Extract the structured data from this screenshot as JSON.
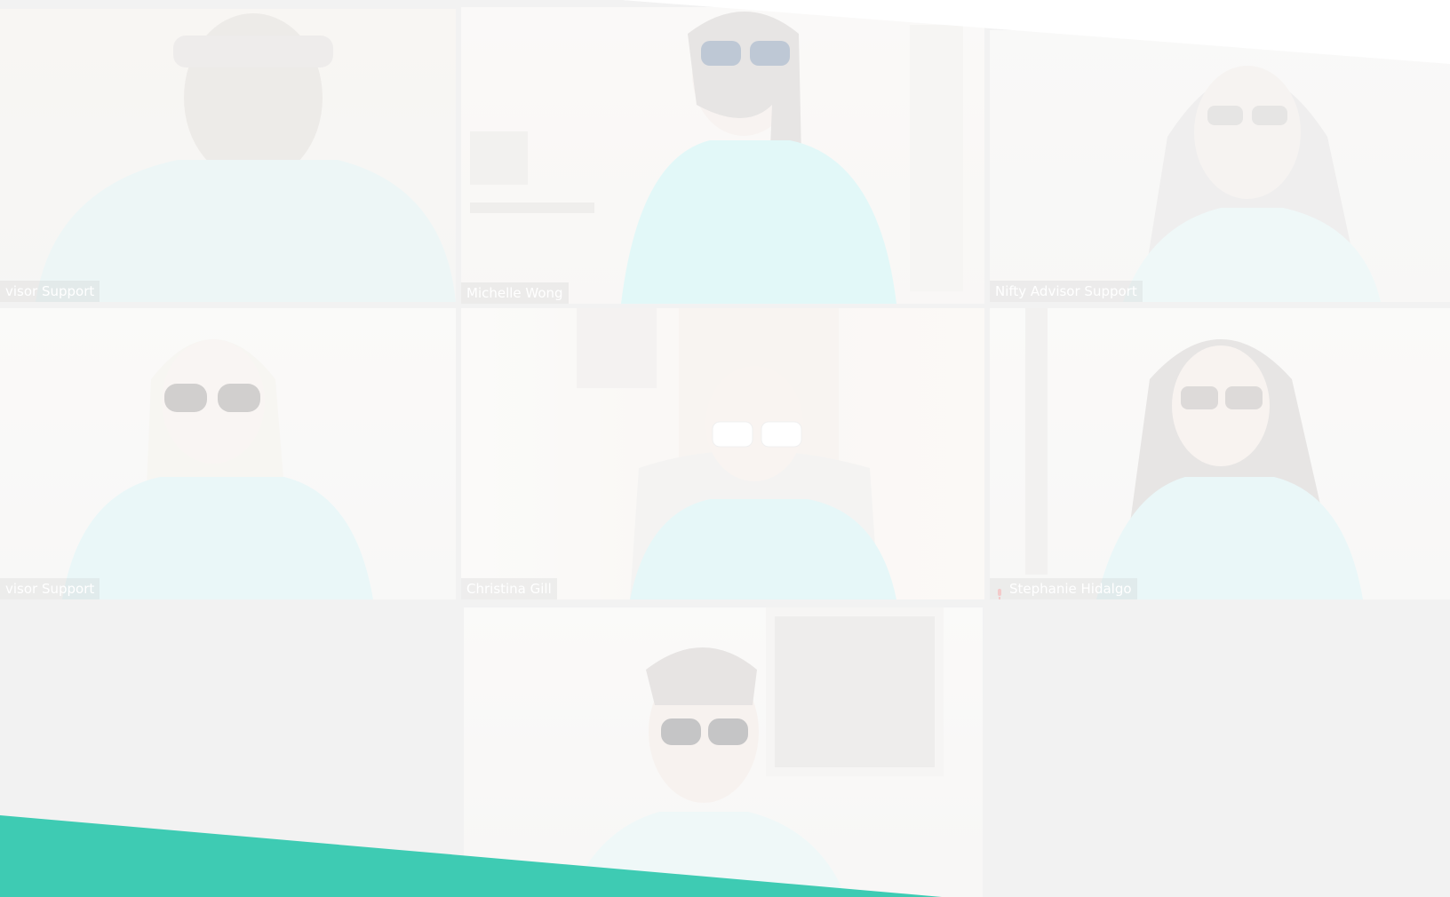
{
  "participants": [
    {
      "name": "visor Support",
      "active": false,
      "muted": false
    },
    {
      "name": "Michelle Wong",
      "active": true,
      "muted": false
    },
    {
      "name": "Nifty Advisor Support",
      "active": false,
      "muted": false
    },
    {
      "name": "visor Support",
      "active": false,
      "muted": false
    },
    {
      "name": "Christina Gill",
      "active": false,
      "muted": false
    },
    {
      "name": "Stephanie Hidalgo",
      "active": false,
      "muted": true
    },
    {
      "name": "",
      "active": false,
      "muted": false
    }
  ],
  "colors": {
    "background": "#e3e3e3",
    "accent_teal": "#3ecbb3",
    "active_border": "#f1f0de",
    "shirt": "#bfeff0",
    "muted_icon": "#e58a8a"
  },
  "icons": {
    "muted": "microphone-muted-icon"
  }
}
